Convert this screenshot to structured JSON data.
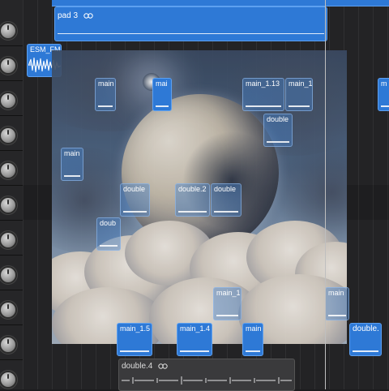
{
  "tracks": {
    "regions": [
      {
        "id": "pad3",
        "label": "pad 3",
        "loop": true
      },
      {
        "id": "esm",
        "label": "ESM_FM"
      },
      {
        "id": "r_main_a",
        "label": "main"
      },
      {
        "id": "r_mai",
        "label": "mai"
      },
      {
        "id": "r_main_113",
        "label": "main_1.13"
      },
      {
        "id": "r_main_1",
        "label": "main_1"
      },
      {
        "id": "r_m_right",
        "label": "m"
      },
      {
        "id": "r_double_a",
        "label": "double"
      },
      {
        "id": "r_main_b",
        "label": "main"
      },
      {
        "id": "r_double_b",
        "label": "double"
      },
      {
        "id": "r_double_2",
        "label": "double.2"
      },
      {
        "id": "r_double_c",
        "label": "double"
      },
      {
        "id": "r_doub",
        "label": "doub"
      },
      {
        "id": "r_main_1b",
        "label": "main_1"
      },
      {
        "id": "r_main_c",
        "label": "main"
      },
      {
        "id": "r_main_15",
        "label": "main_1.5"
      },
      {
        "id": "r_main_14",
        "label": "main_1.4"
      },
      {
        "id": "r_main_d",
        "label": "main"
      },
      {
        "id": "r_double_dot",
        "label": "double."
      },
      {
        "id": "double4",
        "label": "double.4",
        "loop": true
      }
    ]
  },
  "colors": {
    "region_blue": "#2e79d6",
    "background": "#1c1c1e"
  }
}
